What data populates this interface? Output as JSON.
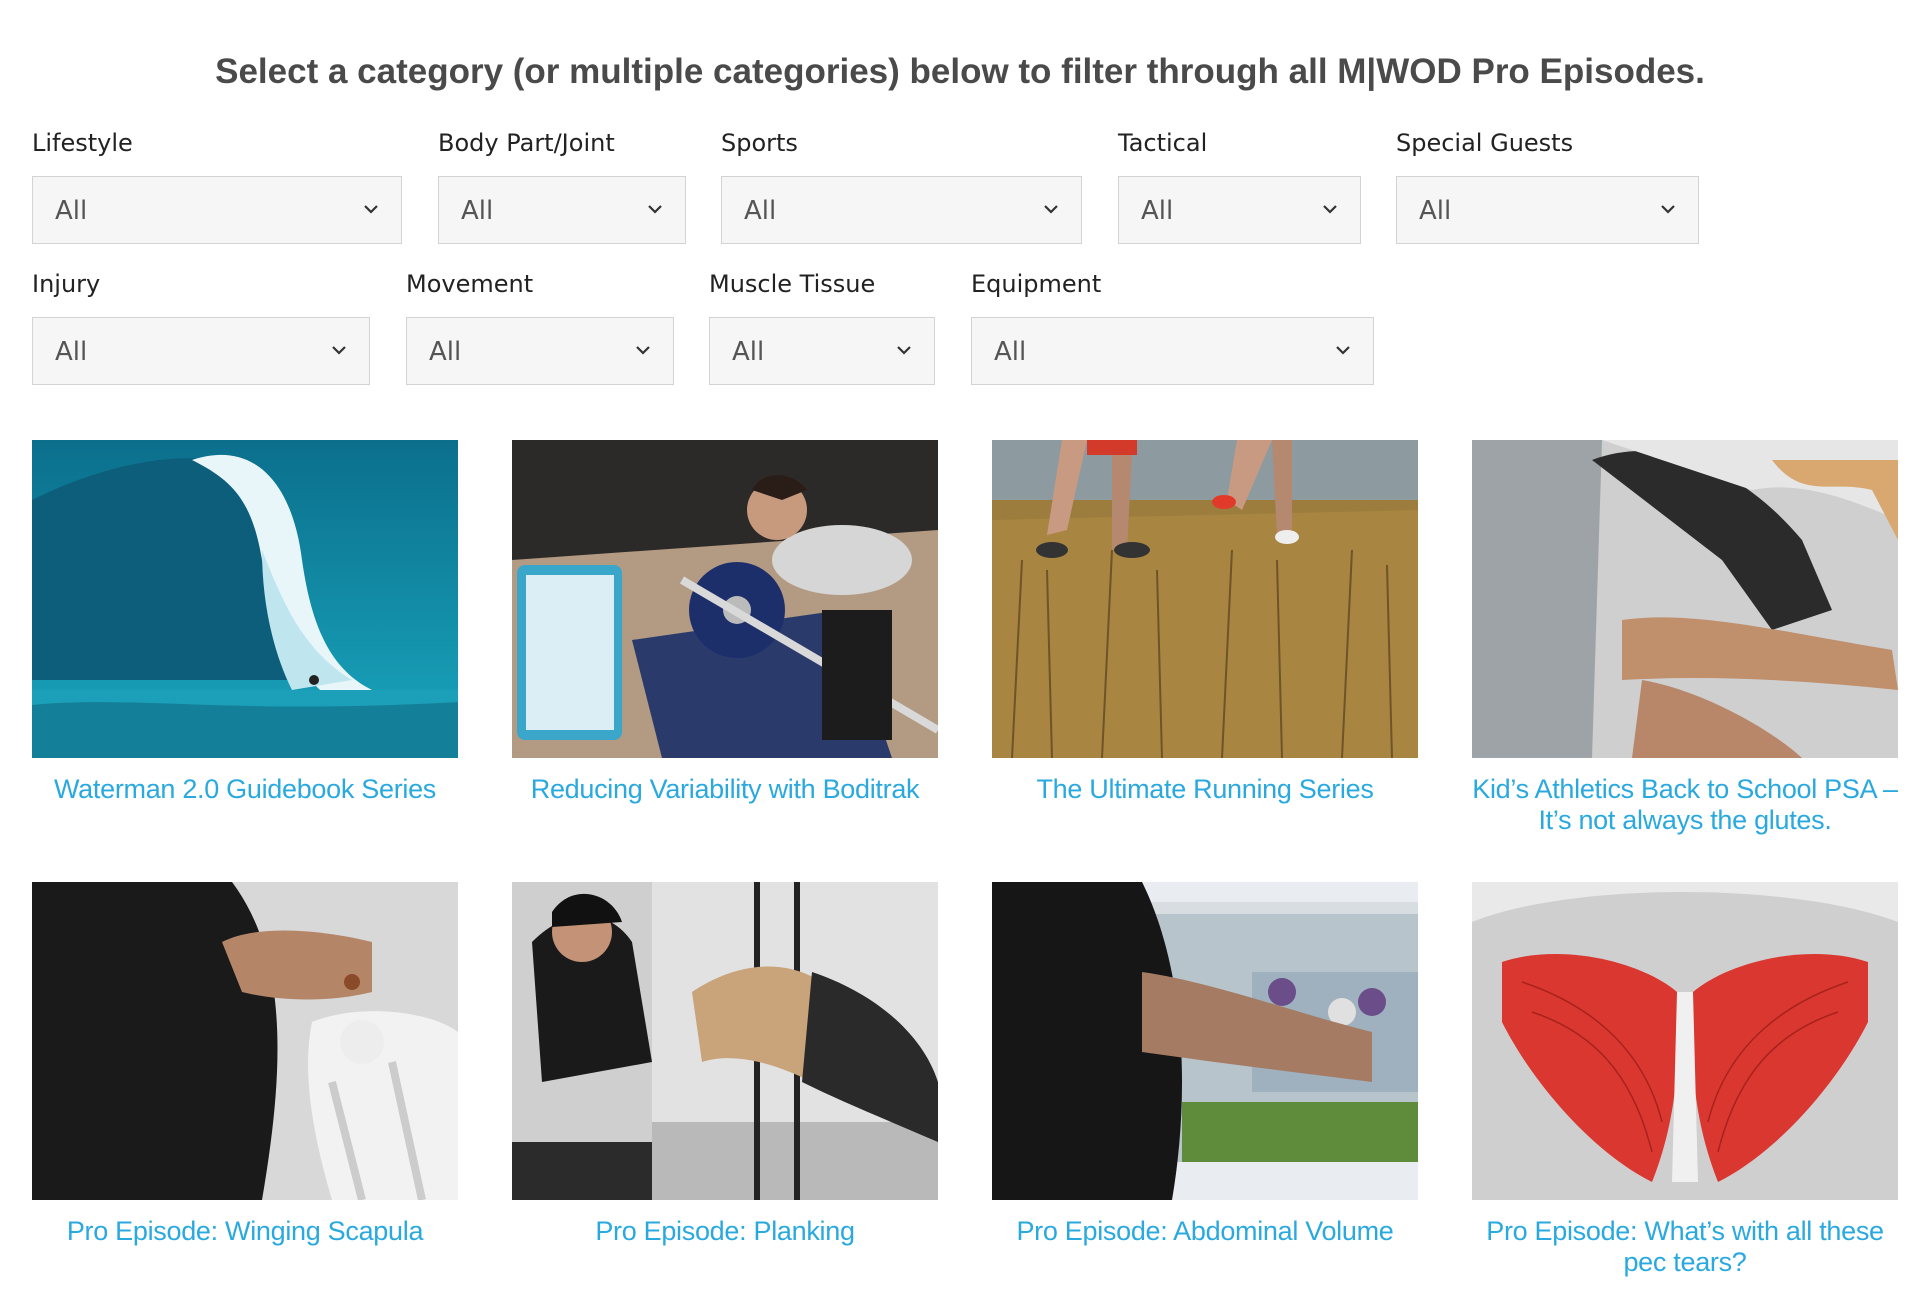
{
  "heading": "Select a category (or multiple categories) below to filter through all M|WOD Pro Episodes.",
  "filters": [
    {
      "label": "Lifestyle",
      "value": "All"
    },
    {
      "label": "Body Part/Joint",
      "value": "All"
    },
    {
      "label": "Sports",
      "value": "All"
    },
    {
      "label": "Tactical",
      "value": "All"
    },
    {
      "label": "Special Guests",
      "value": "All"
    },
    {
      "label": "Injury",
      "value": "All"
    },
    {
      "label": "Movement",
      "value": "All"
    },
    {
      "label": "Muscle Tissue",
      "value": "All"
    },
    {
      "label": "Equipment",
      "value": "All"
    }
  ],
  "episodes": [
    {
      "title": "Waterman 2.0 Guidebook Series",
      "image": "surfing-wave-photo"
    },
    {
      "title": "Reducing Variability with Boditrak",
      "image": "barbell-deadlift-photo"
    },
    {
      "title": "The Ultimate Running Series",
      "image": "runners-in-field-photo"
    },
    {
      "title": "Kid’s Athletics Back to School PSA – It’s not always the glutes.",
      "image": "coach-mobility-photo"
    },
    {
      "title": "Pro Episode: Winging Scapula",
      "image": "skeleton-shoulder-photo"
    },
    {
      "title": "Pro Episode: Planking",
      "image": "suspension-trainer-plank-photo"
    },
    {
      "title": "Pro Episode: Abdominal Volume",
      "image": "coach-pointing-screen-photo"
    },
    {
      "title": "Pro Episode: What’s with all these pec tears?",
      "image": "pectoral-muscle-anatomy-illustration"
    }
  ],
  "colors": {
    "link": "#29a9df",
    "heading": "#4a4a4a",
    "select_bg": "#f6f6f6",
    "select_border": "#d3d3d3"
  }
}
